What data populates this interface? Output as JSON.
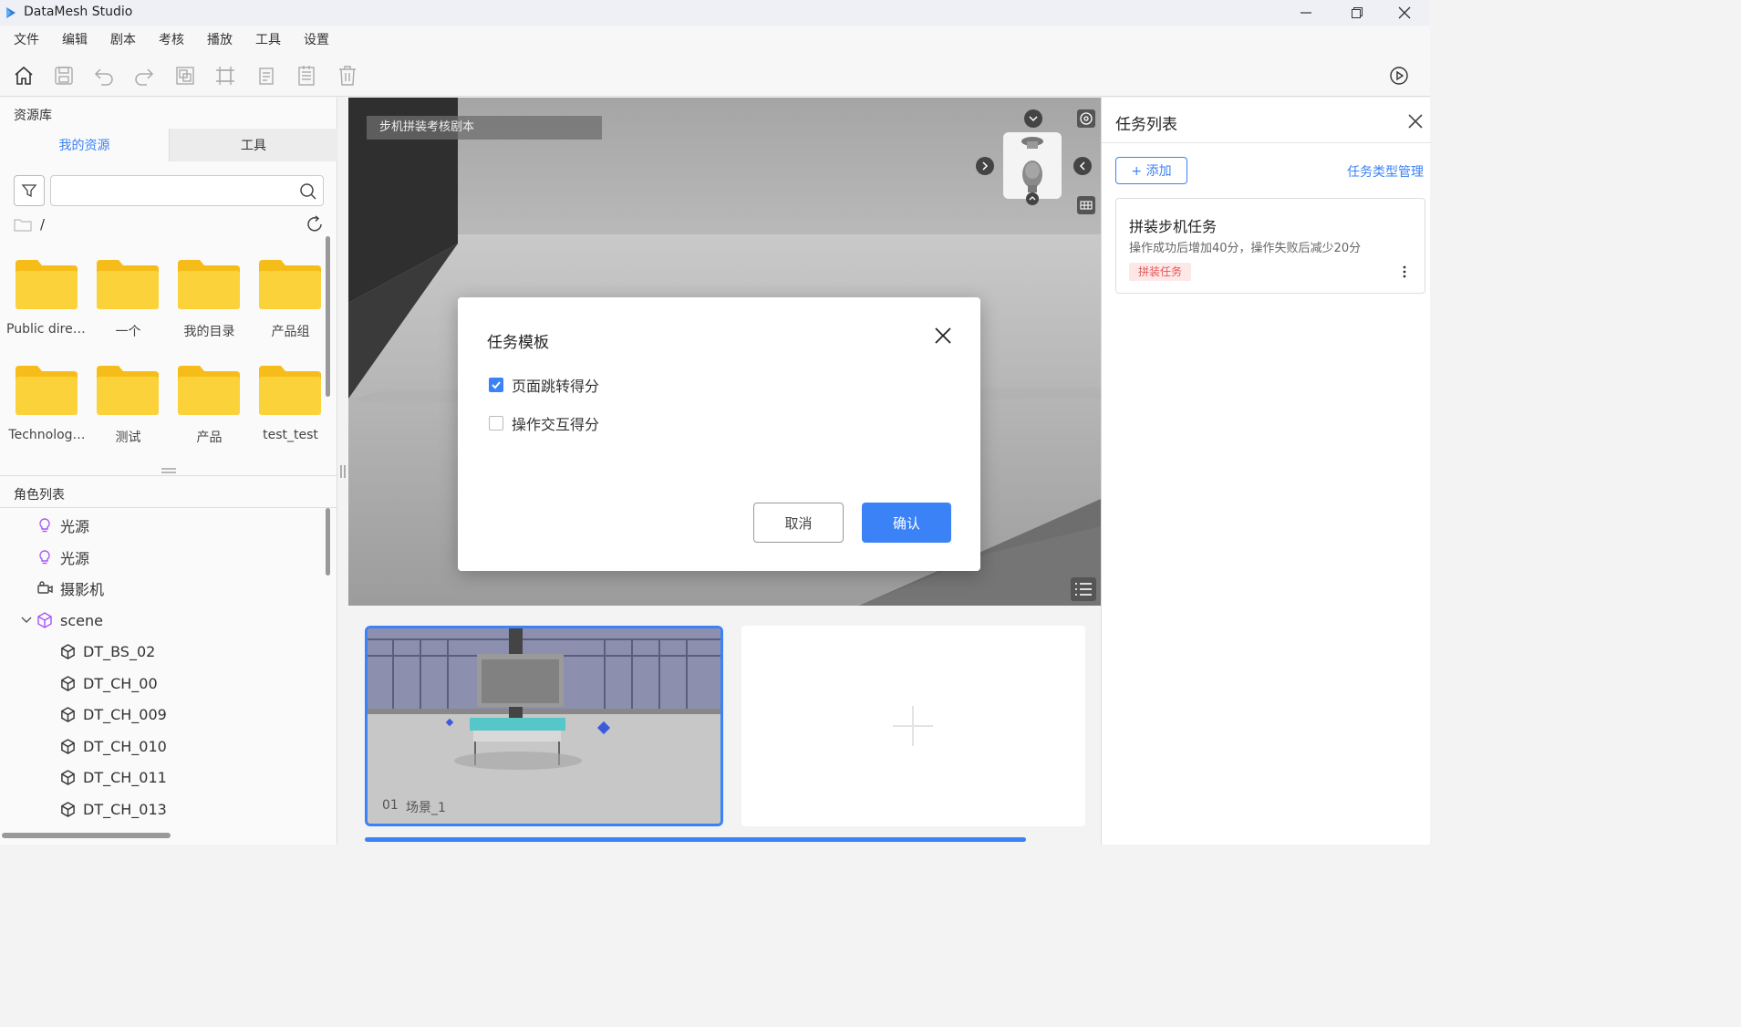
{
  "app": {
    "title": "DataMesh Studio"
  },
  "menu": [
    "文件",
    "编辑",
    "剧本",
    "考核",
    "播放",
    "工具",
    "设置"
  ],
  "toolbar": {
    "tools": [
      "home-icon",
      "save-icon",
      "undo-icon",
      "redo-icon",
      "group-icon",
      "align-icon",
      "copy-icon",
      "list-icon",
      "delete-icon"
    ],
    "play_icon": "play-icon"
  },
  "resources": {
    "title": "资源库",
    "tabs": [
      "我的资源",
      "工具"
    ],
    "active_tab": "我的资源",
    "search": {
      "value": "",
      "placeholder": ""
    },
    "path": "/",
    "folders": [
      "Public direc…",
      "一个",
      "我的目录",
      "产品组",
      "Technolog…",
      "测试",
      "产品",
      "test_test"
    ]
  },
  "roles": {
    "title": "角色列表",
    "items": [
      {
        "label": "光源",
        "icon": "bulb-icon",
        "indent": 0
      },
      {
        "label": "光源",
        "icon": "bulb-icon",
        "indent": 0
      },
      {
        "label": "摄影机",
        "icon": "camera-icon",
        "indent": 0
      },
      {
        "label": "scene",
        "icon": "cube-icon",
        "indent": 0,
        "expanded": true
      },
      {
        "label": "DT_BS_02",
        "icon": "model-icon",
        "indent": 1
      },
      {
        "label": "DT_CH_00",
        "icon": "model-icon",
        "indent": 1
      },
      {
        "label": "DT_CH_009",
        "icon": "model-icon",
        "indent": 1
      },
      {
        "label": "DT_CH_010",
        "icon": "model-icon",
        "indent": 1
      },
      {
        "label": "DT_CH_011",
        "icon": "model-icon",
        "indent": 1
      },
      {
        "label": "DT_CH_013",
        "icon": "model-icon",
        "indent": 1
      }
    ]
  },
  "viewport": {
    "scene_label": "步机拼装考核剧本"
  },
  "dialog": {
    "title": "任务模板",
    "options": [
      {
        "label": "页面跳转得分",
        "checked": true
      },
      {
        "label": "操作交互得分",
        "checked": false
      }
    ],
    "cancel": "取消",
    "confirm": "确认"
  },
  "scenes": {
    "items": [
      {
        "index": "01",
        "name": "场景_1",
        "selected": true
      }
    ],
    "add_icon": "plus-icon"
  },
  "tasks": {
    "title": "任务列表",
    "add_label": "+ 添加",
    "manage_label": "任务类型管理",
    "items": [
      {
        "name": "拼装步机任务",
        "desc": "操作成功后增加40分，操作失败后减少20分",
        "tag": "拼装任务"
      }
    ]
  },
  "colors": {
    "accent": "#3b82f6",
    "folder": "#f6bd1a",
    "tag_bg": "#fde8e8",
    "tag_text": "#e45656"
  }
}
